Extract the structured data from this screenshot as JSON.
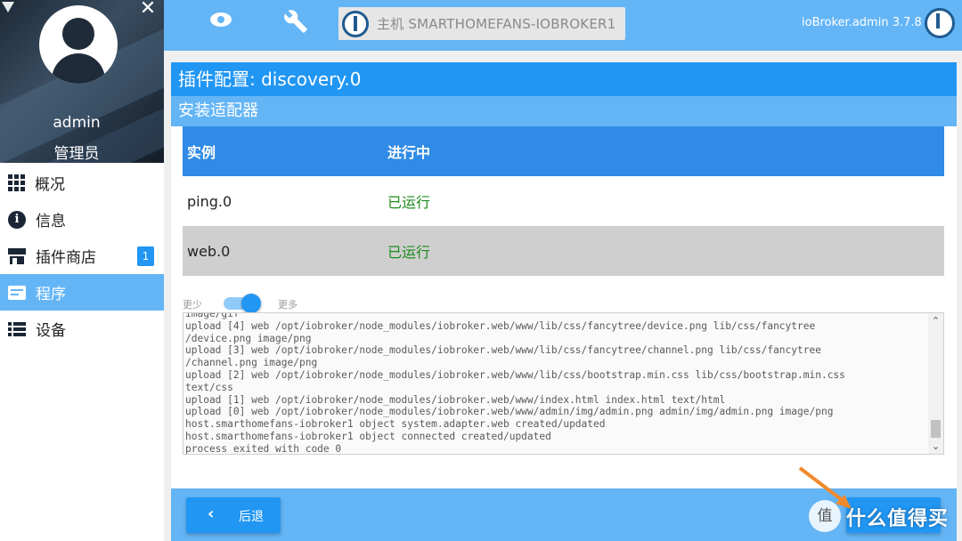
{
  "sidebar": {
    "user": {
      "name": "admin",
      "role": "管理员"
    },
    "items": [
      {
        "label": "概况",
        "icon": "grid-icon"
      },
      {
        "label": "信息",
        "icon": "info-icon"
      },
      {
        "label": "插件商店",
        "icon": "store-icon",
        "badge": "1"
      },
      {
        "label": "程序",
        "icon": "instances-icon",
        "active": true
      },
      {
        "label": "设备",
        "icon": "list-icon"
      }
    ]
  },
  "topbar": {
    "host_label": "主机 SMARTHOMEFANS-IOBROKER1",
    "version": "ioBroker.admin 3.7.8"
  },
  "dialog": {
    "title": "插件配置: discovery.0",
    "subtitle": "安装适配器",
    "columns": [
      "实例",
      "进行中"
    ],
    "rows": [
      {
        "instance": "ping.0",
        "status": "已运行"
      },
      {
        "instance": "web.0",
        "status": "已运行"
      }
    ],
    "toggle": {
      "less_label": "更少",
      "more_label": "更多",
      "on": true
    },
    "log_lines": [
      "image/gif",
      "upload [4] web /opt/iobroker/node_modules/iobroker.web/www/lib/css/fancytree/device.png lib/css/fancytree",
      "/device.png image/png",
      "upload [3] web /opt/iobroker/node_modules/iobroker.web/www/lib/css/fancytree/channel.png lib/css/fancytree",
      "/channel.png image/png",
      "upload [2] web /opt/iobroker/node_modules/iobroker.web/www/lib/css/bootstrap.min.css lib/css/bootstrap.min.css",
      "text/css",
      "upload [1] web /opt/iobroker/node_modules/iobroker.web/www/index.html index.html text/html",
      "upload [0] web /opt/iobroker/node_modules/iobroker.web/www/admin/img/admin.png admin/img/admin.png image/png",
      "host.smarthomefans-iobroker1 object system.adapter.web created/updated",
      "host.smarthomefans-iobroker1 object connected created/updated",
      "process exited with code 0"
    ],
    "back_label": "后退"
  },
  "watermark": {
    "circle": "值",
    "text": "什么值得买"
  },
  "colors": {
    "accent": "#2196f3",
    "accent_light": "#64b5f6",
    "success_text": "#1d8b1d",
    "annotation_arrow": "#f08a2c"
  }
}
